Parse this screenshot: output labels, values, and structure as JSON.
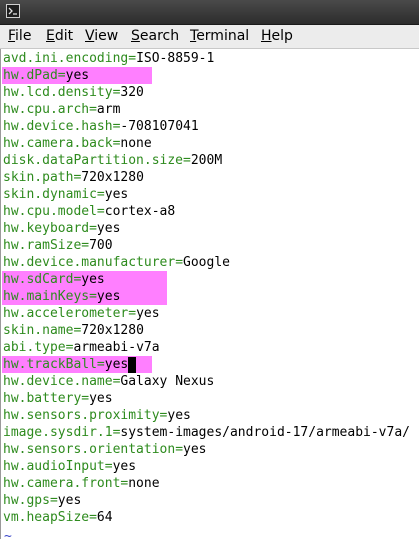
{
  "window": {
    "icon": "terminal-icon"
  },
  "menu": {
    "file": {
      "m": "F",
      "r": "ile"
    },
    "edit": {
      "m": "E",
      "r": "dit"
    },
    "view": {
      "m": "V",
      "r": "iew"
    },
    "search": {
      "m": "S",
      "r": "earch"
    },
    "terminal": {
      "m": "T",
      "r": "erminal"
    },
    "help": {
      "m": "H",
      "r": "elp"
    }
  },
  "editor": {
    "lines": [
      {
        "key": "avd.ini.encoding",
        "value": "ISO-8859-1"
      },
      {
        "key": "hw.dPad",
        "value": "yes"
      },
      {
        "key": "hw.lcd.density",
        "value": "320"
      },
      {
        "key": "hw.cpu.arch",
        "value": "arm"
      },
      {
        "key": "hw.device.hash",
        "value": "-708107041"
      },
      {
        "key": "hw.camera.back",
        "value": "none"
      },
      {
        "key": "disk.dataPartition.size",
        "value": "200M"
      },
      {
        "key": "skin.path",
        "value": "720x1280"
      },
      {
        "key": "skin.dynamic",
        "value": "yes"
      },
      {
        "key": "hw.cpu.model",
        "value": "cortex-a8"
      },
      {
        "key": "hw.keyboard",
        "value": "yes"
      },
      {
        "key": "hw.ramSize",
        "value": "700"
      },
      {
        "key": "hw.device.manufacturer",
        "value": "Google"
      },
      {
        "key": "hw.sdCard",
        "value": "yes"
      },
      {
        "key": "hw.mainKeys",
        "value": "yes"
      },
      {
        "key": "hw.accelerometer",
        "value": "yes"
      },
      {
        "key": "skin.name",
        "value": "720x1280"
      },
      {
        "key": "abi.type",
        "value": "armeabi-v7a"
      },
      {
        "key": "hw.trackBall",
        "value": "yes"
      },
      {
        "key": "hw.device.name",
        "value": "Galaxy Nexus"
      },
      {
        "key": "hw.battery",
        "value": "yes"
      },
      {
        "key": "hw.sensors.proximity",
        "value": "yes"
      },
      {
        "key": "image.sysdir.1",
        "value": "system-images/android-17/armeabi-v7a/"
      },
      {
        "key": "hw.sensors.orientation",
        "value": "yes"
      },
      {
        "key": "hw.audioInput",
        "value": "yes"
      },
      {
        "key": "hw.camera.front",
        "value": "none"
      },
      {
        "key": "hw.gps",
        "value": "yes"
      },
      {
        "key": "vm.heapSize",
        "value": "64"
      }
    ],
    "eq": "=",
    "end_marker": "~",
    "highlight_color": "#ff7fff",
    "key_color": "#2e8b1e",
    "tilde_color": "#3a46c8"
  }
}
